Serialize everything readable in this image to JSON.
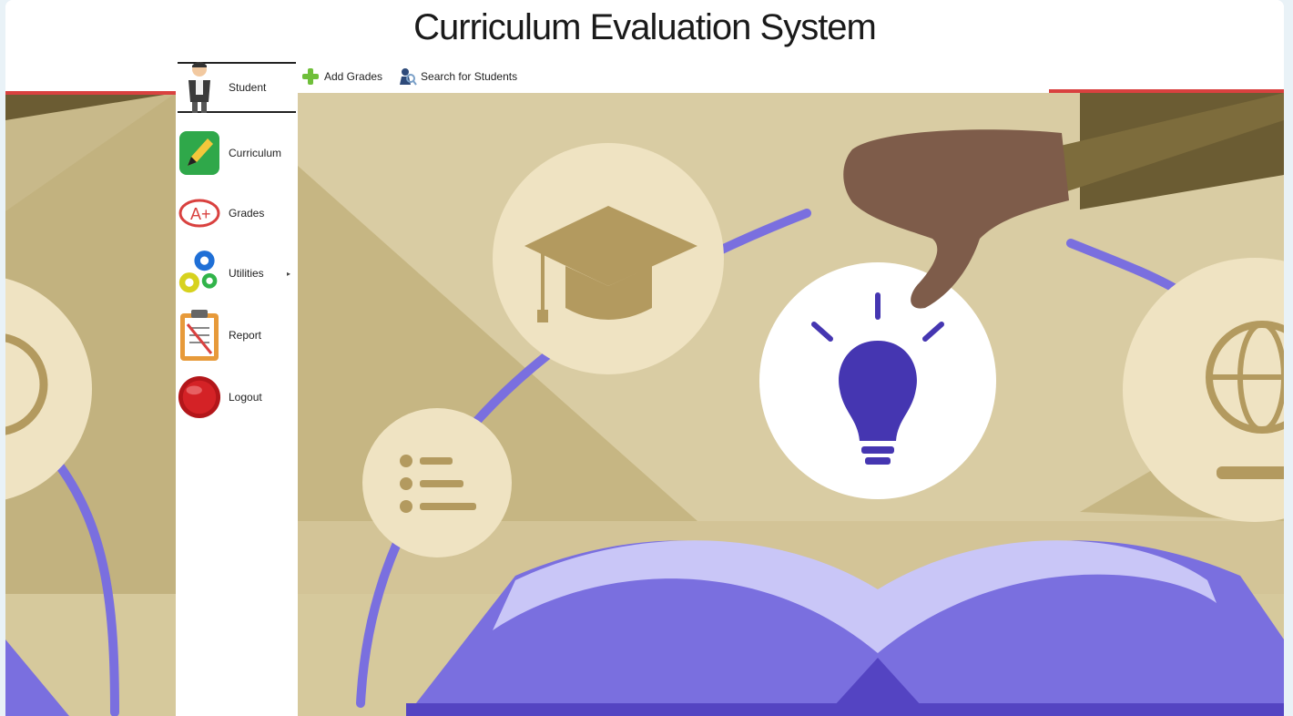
{
  "app": {
    "title": "Curriculum Evaluation System"
  },
  "toolbar": {
    "add_grades": "Add Grades",
    "search_students": "Search for Students"
  },
  "sidebar": {
    "items": [
      {
        "label": "Student",
        "icon": "student-icon"
      },
      {
        "label": "Curriculum",
        "icon": "pencil-icon"
      },
      {
        "label": "Grades",
        "icon": "grade-a-icon"
      },
      {
        "label": "Utilities",
        "icon": "gears-icon",
        "submenu_arrow": "▸"
      },
      {
        "label": "Report",
        "icon": "clipboard-icon"
      },
      {
        "label": "Logout",
        "icon": "logout-icon"
      }
    ]
  },
  "colors": {
    "accent": "#d9413f",
    "background_tan": "#d9cca3",
    "purple": "#7a6fdf",
    "dark_purple": "#4536b1"
  }
}
